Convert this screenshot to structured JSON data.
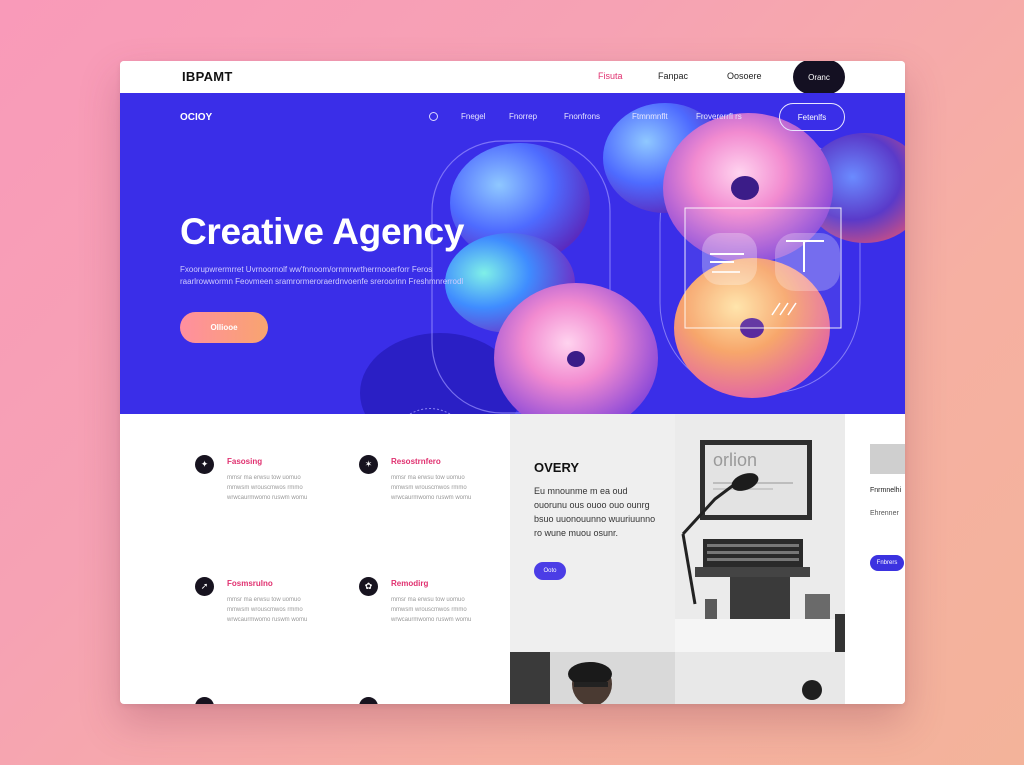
{
  "topbar": {
    "brand": "IBPAMT",
    "nav": [
      "Fisuta",
      "Fanpac",
      "Oosoere"
    ],
    "pill": "Oranc"
  },
  "hero": {
    "logo": "OCIOY",
    "nav": [
      "Fnegel",
      "Fnorrep",
      "Fnonfrons",
      "Ftmnmnflt",
      "Frovererrfl rs"
    ],
    "outline_button": "Fetenlfs",
    "title": "Creative Agency",
    "subtitle": "Fxoorupwrermrret Uvrnoornolf ww'fnnoom/ornmrwrtherrnooerforr Feros raarlrowwormn Feovmeen sramrormeroraerdnvoenfe sreroorinn Freshmnrerrodl",
    "cta": "Olliooe",
    "colors": {
      "bg": "#3a2ee8",
      "cta": "#ff8f9f"
    }
  },
  "features": [
    {
      "title": "Fasosing",
      "desc": "mmsr ma erwsu tow uomuo mmwsm wrouscmwos rmmo wrwcaurmwomo ruswm womu"
    },
    {
      "title": "Resostrnfero",
      "desc": "mmsr ma erwsu tow uomuo mmwsm wrouscmwos rmmo wrwcaurmwomo ruswm womu"
    },
    {
      "title": "Fosmsrulno",
      "desc": "mmsr ma erwsu tow uomuo mmwsm wrouscmwos rmmo wrwcaurmwomo ruswm womu"
    },
    {
      "title": "Remodirg",
      "desc": "mmsr ma erwsu tow uomuo mmwsm wrouscmwos rmmo wrwcaurmwomo ruswm womu"
    }
  ],
  "panel": {
    "title": "OVERY",
    "desc": "Eu mnounme m ea oud ouorunu ous ouoo ouo ounrg bsuo uuonouunno wuuriuunno ro wune muou osunr.",
    "button": "Ooto"
  },
  "rightcol": {
    "title": "Fnrmnelhi",
    "sub": "Ehrenner",
    "button": "Fnbrers"
  },
  "photo": {
    "sign": "orlion"
  }
}
